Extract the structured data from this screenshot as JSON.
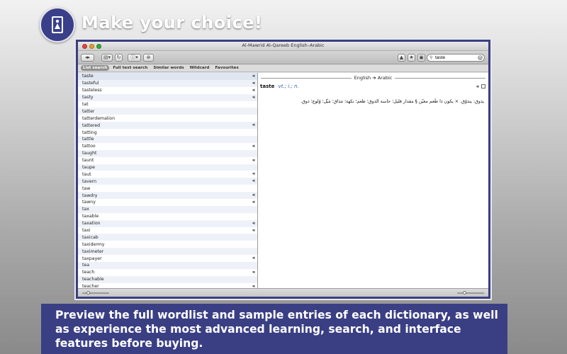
{
  "promo": {
    "headline": "Make your choice!",
    "caption": "Preview the full wordlist and sample entries of each dictionary, as well as experience the most advanced learning, search, and interface features before buying."
  },
  "window": {
    "title": "Al-Mawrid Al-Qareeb English–Arabic"
  },
  "toolbar": {
    "search_value": "taste"
  },
  "tabs": [
    {
      "label": "List search",
      "active": true
    },
    {
      "label": "Full text search",
      "active": false
    },
    {
      "label": "Similar words",
      "active": false
    },
    {
      "label": "Wildcard",
      "active": false
    },
    {
      "label": "Favourites",
      "active": false
    }
  ],
  "wordlist": [
    {
      "word": "taste",
      "audio": true
    },
    {
      "word": "tasteful",
      "audio": true
    },
    {
      "word": "tasteless",
      "audio": true
    },
    {
      "word": "tasty",
      "audio": true
    },
    {
      "word": "tat",
      "audio": false
    },
    {
      "word": "tatter",
      "audio": false
    },
    {
      "word": "tatterdemalion",
      "audio": false
    },
    {
      "word": "tattered",
      "audio": true
    },
    {
      "word": "tatting",
      "audio": false
    },
    {
      "word": "tattle",
      "audio": false
    },
    {
      "word": "tattoo",
      "audio": true
    },
    {
      "word": "taught",
      "audio": false
    },
    {
      "word": "taunt",
      "audio": true
    },
    {
      "word": "taupe",
      "audio": false
    },
    {
      "word": "taut",
      "audio": true
    },
    {
      "word": "tavern",
      "audio": true
    },
    {
      "word": "taw",
      "audio": false
    },
    {
      "word": "tawdry",
      "audio": true
    },
    {
      "word": "tawny",
      "audio": true
    },
    {
      "word": "tax",
      "audio": false
    },
    {
      "word": "taxable",
      "audio": false
    },
    {
      "word": "taxation",
      "audio": true
    },
    {
      "word": "taxi",
      "audio": true
    },
    {
      "word": "taxicab",
      "audio": false
    },
    {
      "word": "taxidermy",
      "audio": false
    },
    {
      "word": "taximeter",
      "audio": false
    },
    {
      "word": "taxpayer",
      "audio": true
    },
    {
      "word": "tea",
      "audio": false
    },
    {
      "word": "teach",
      "audio": true
    },
    {
      "word": "teachable",
      "audio": false
    },
    {
      "word": "teacher",
      "audio": true
    }
  ],
  "entry": {
    "direction": "English ➔ Arabic",
    "headword": "taste",
    "pos": "vt.; i.; n.",
    "translation": "يذوق: يتذوّق. × يكون ذا طَعم معيّن § مقدار قليل؛ حاسة الذوق؛ طعم؛ نكهة؛ مَذاق؛ مَيْل؛ وُلوع؛ ذوق."
  },
  "colors": {
    "accent": "#3a3f84",
    "selection": "#8f8f8f"
  }
}
